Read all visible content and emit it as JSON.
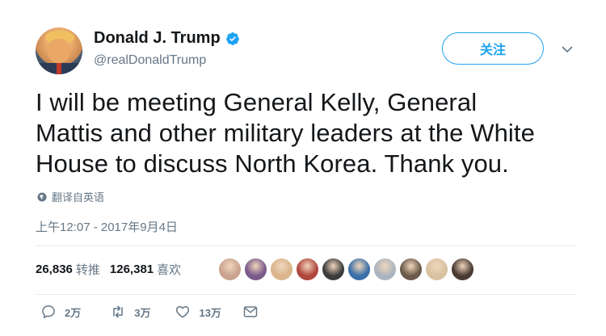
{
  "author": {
    "display_name": "Donald J. Trump",
    "handle": "@realDonaldTrump",
    "verified": true
  },
  "follow_label": "关注",
  "tweet": {
    "lines": [
      "I will be meeting General Kelly, General",
      "Mattis and other military leaders at the White",
      "House to discuss North Korea. Thank you."
    ]
  },
  "translate_label": "翻译自英语",
  "timestamp": "上午12:07 - 2017年9月4日",
  "stats": {
    "retweets": "26,836",
    "retweets_label": "转推",
    "likes": "126,381",
    "likes_label": "喜欢"
  },
  "likers": [
    {
      "color": "#c9a38e"
    },
    {
      "color": "#7a5a8a"
    },
    {
      "color": "#d9b48c"
    },
    {
      "color": "#b0463c"
    },
    {
      "color": "#3c3c3c"
    },
    {
      "color": "#3b6fa8"
    },
    {
      "color": "#aab4be"
    },
    {
      "color": "#6b5a4a"
    },
    {
      "color": "#d8c2a0"
    },
    {
      "color": "#4a3a32"
    }
  ],
  "actions": {
    "reply_count": "2万",
    "retweet_count": "3万",
    "like_count": "13万"
  },
  "colors": {
    "accent": "#1da1f2",
    "secondary_text": "#657786",
    "divider": "#e6ecf0"
  }
}
